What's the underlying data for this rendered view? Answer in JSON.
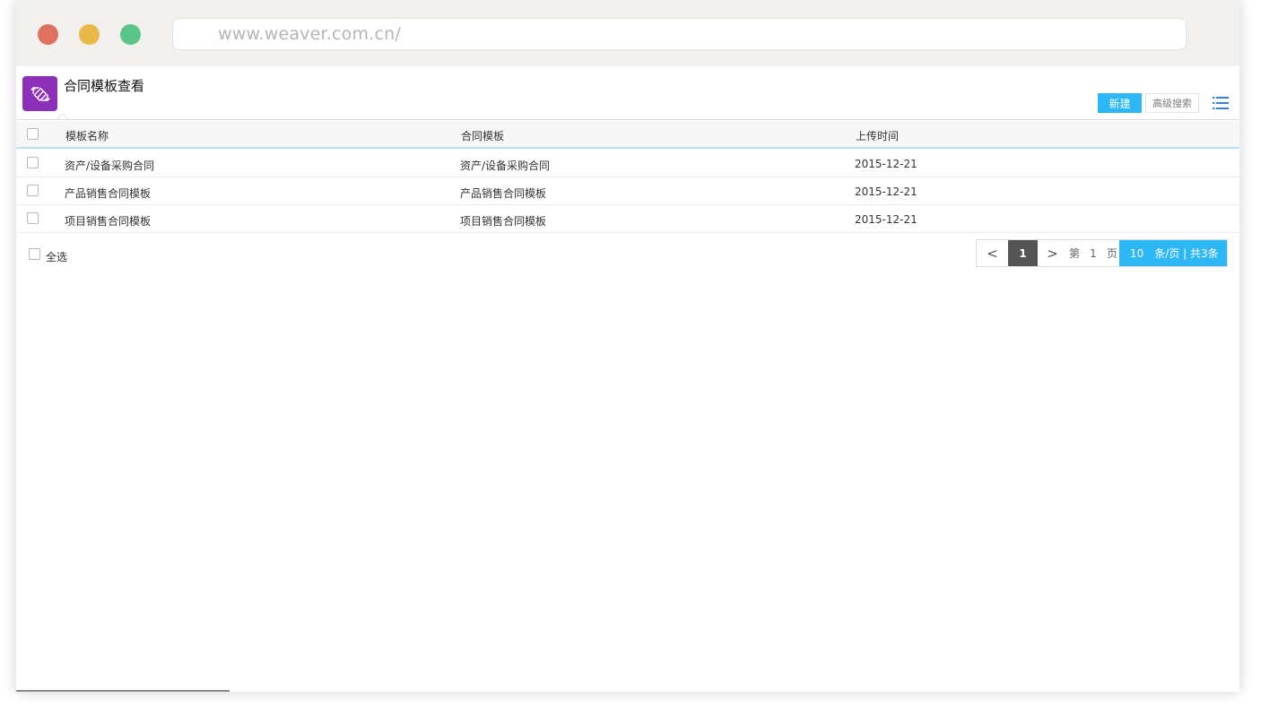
{
  "browser": {
    "url": "www.weaver.com.cn/",
    "traffic_lights": {
      "close_color": "#e0705f",
      "minimize_color": "#e8b947",
      "maximize_color": "#5ac587"
    }
  },
  "app": {
    "title": "合同模板查看",
    "icon": "contract-exchange-icon",
    "icon_color": "#8b2fb8",
    "accent_color": "#2db7f5"
  },
  "toolbar": {
    "new_label": "新建",
    "advanced_search_label": "高级搜索",
    "menu_icon": "list-menu-icon"
  },
  "table": {
    "columns": [
      "模板名称",
      "合同模板",
      "上传时间"
    ],
    "rows": [
      {
        "name": "资产/设备采购合同",
        "template": "资产/设备采购合同",
        "upload_time": "2015-12-21"
      },
      {
        "name": "产品销售合同模板",
        "template": "产品销售合同模板",
        "upload_time": "2015-12-21"
      },
      {
        "name": "项目销售合同模板",
        "template": "项目销售合同模板",
        "upload_time": "2015-12-21"
      }
    ]
  },
  "footer": {
    "select_all_label": "全选",
    "pagination": {
      "prev": "<",
      "current_page": "1",
      "next": ">",
      "page_prefix": "第",
      "page_input": "1",
      "page_suffix": "页",
      "page_size": "10",
      "page_size_suffix": "条/页 | 共3条"
    }
  }
}
